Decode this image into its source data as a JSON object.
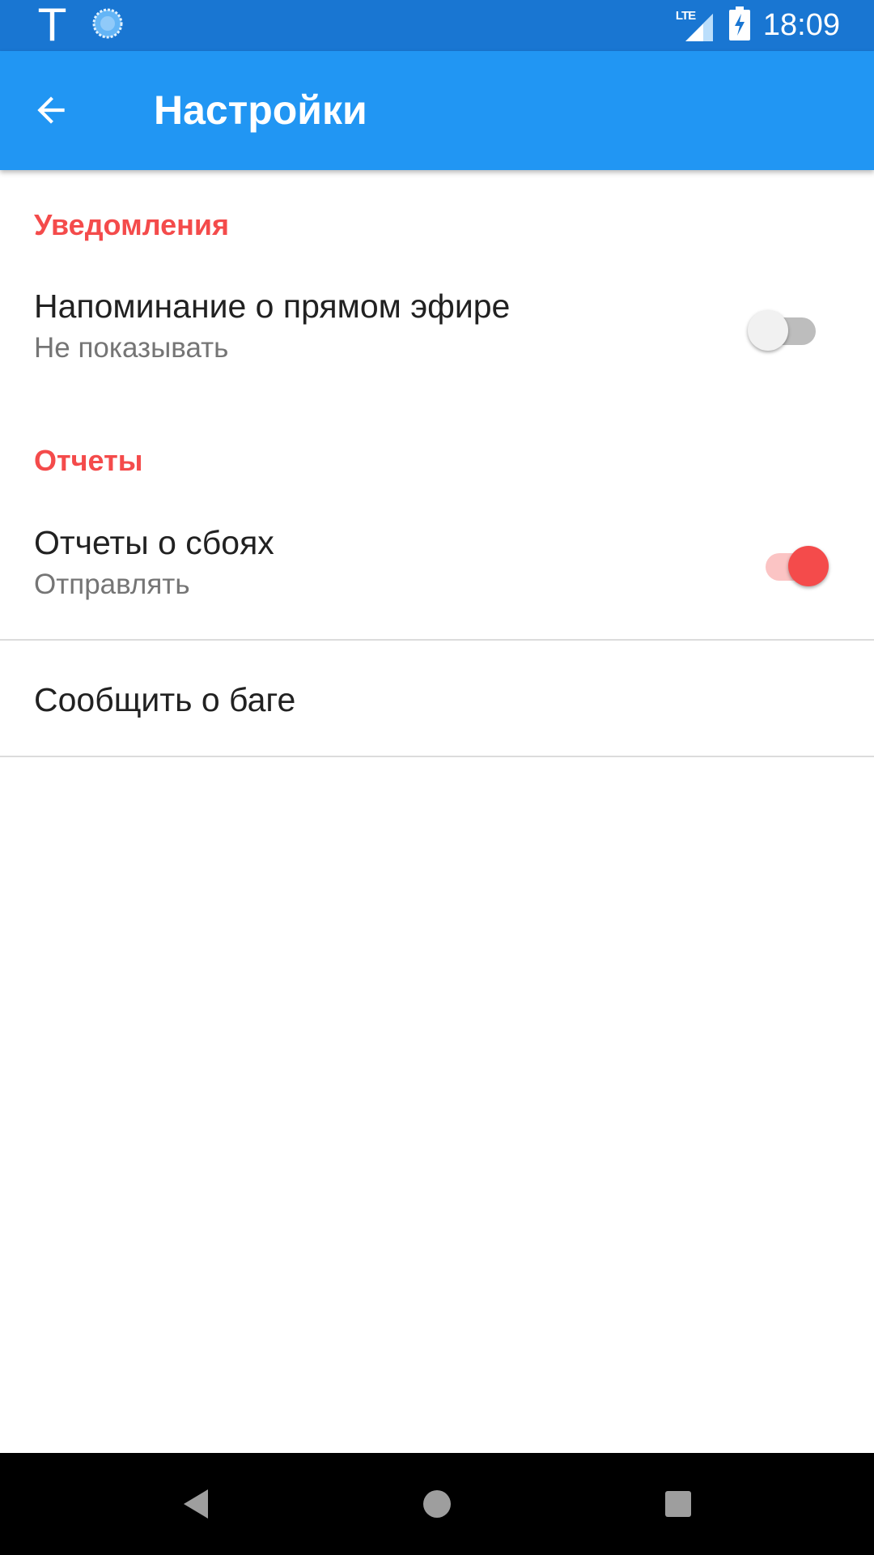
{
  "status_bar": {
    "carrier_letter": "T",
    "network_label": "LTE",
    "time": "18:09"
  },
  "app_bar": {
    "back_icon": "arrow-back-icon",
    "title": "Настройки"
  },
  "sections": [
    {
      "header": "Уведомления",
      "items": [
        {
          "title": "Напоминание о прямом эфире",
          "summary": "Не показывать",
          "switch_on": false
        }
      ]
    },
    {
      "header": "Отчеты",
      "items": [
        {
          "title": "Отчеты о сбоях",
          "summary": "Отправлять",
          "switch_on": true
        }
      ]
    }
  ],
  "actions": [
    {
      "title": "Сообщить о баге"
    }
  ],
  "colors": {
    "status_bar": "#1976D2",
    "app_bar": "#2196F3",
    "accent": "#F44B4B",
    "nav_bar": "#000000"
  },
  "nav_bar": {
    "back_icon": "nav-back-icon",
    "home_icon": "nav-home-icon",
    "recents_icon": "nav-recents-icon"
  }
}
